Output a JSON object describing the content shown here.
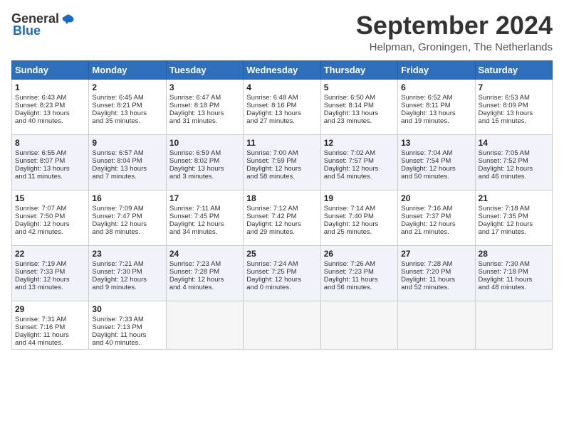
{
  "logo": {
    "general": "General",
    "blue": "Blue"
  },
  "title": "September 2024",
  "location": "Helpman, Groningen, The Netherlands",
  "days_of_week": [
    "Sunday",
    "Monday",
    "Tuesday",
    "Wednesday",
    "Thursday",
    "Friday",
    "Saturday"
  ],
  "weeks": [
    [
      {
        "num": "1",
        "lines": [
          "Sunrise: 6:43 AM",
          "Sunset: 8:23 PM",
          "Daylight: 13 hours",
          "and 40 minutes."
        ]
      },
      {
        "num": "2",
        "lines": [
          "Sunrise: 6:45 AM",
          "Sunset: 8:21 PM",
          "Daylight: 13 hours",
          "and 35 minutes."
        ]
      },
      {
        "num": "3",
        "lines": [
          "Sunrise: 6:47 AM",
          "Sunset: 8:18 PM",
          "Daylight: 13 hours",
          "and 31 minutes."
        ]
      },
      {
        "num": "4",
        "lines": [
          "Sunrise: 6:48 AM",
          "Sunset: 8:16 PM",
          "Daylight: 13 hours",
          "and 27 minutes."
        ]
      },
      {
        "num": "5",
        "lines": [
          "Sunrise: 6:50 AM",
          "Sunset: 8:14 PM",
          "Daylight: 13 hours",
          "and 23 minutes."
        ]
      },
      {
        "num": "6",
        "lines": [
          "Sunrise: 6:52 AM",
          "Sunset: 8:11 PM",
          "Daylight: 13 hours",
          "and 19 minutes."
        ]
      },
      {
        "num": "7",
        "lines": [
          "Sunrise: 6:53 AM",
          "Sunset: 8:09 PM",
          "Daylight: 13 hours",
          "and 15 minutes."
        ]
      }
    ],
    [
      {
        "num": "8",
        "lines": [
          "Sunrise: 6:55 AM",
          "Sunset: 8:07 PM",
          "Daylight: 13 hours",
          "and 11 minutes."
        ]
      },
      {
        "num": "9",
        "lines": [
          "Sunrise: 6:57 AM",
          "Sunset: 8:04 PM",
          "Daylight: 13 hours",
          "and 7 minutes."
        ]
      },
      {
        "num": "10",
        "lines": [
          "Sunrise: 6:59 AM",
          "Sunset: 8:02 PM",
          "Daylight: 13 hours",
          "and 3 minutes."
        ]
      },
      {
        "num": "11",
        "lines": [
          "Sunrise: 7:00 AM",
          "Sunset: 7:59 PM",
          "Daylight: 12 hours",
          "and 58 minutes."
        ]
      },
      {
        "num": "12",
        "lines": [
          "Sunrise: 7:02 AM",
          "Sunset: 7:57 PM",
          "Daylight: 12 hours",
          "and 54 minutes."
        ]
      },
      {
        "num": "13",
        "lines": [
          "Sunrise: 7:04 AM",
          "Sunset: 7:54 PM",
          "Daylight: 12 hours",
          "and 50 minutes."
        ]
      },
      {
        "num": "14",
        "lines": [
          "Sunrise: 7:05 AM",
          "Sunset: 7:52 PM",
          "Daylight: 12 hours",
          "and 46 minutes."
        ]
      }
    ],
    [
      {
        "num": "15",
        "lines": [
          "Sunrise: 7:07 AM",
          "Sunset: 7:50 PM",
          "Daylight: 12 hours",
          "and 42 minutes."
        ]
      },
      {
        "num": "16",
        "lines": [
          "Sunrise: 7:09 AM",
          "Sunset: 7:47 PM",
          "Daylight: 12 hours",
          "and 38 minutes."
        ]
      },
      {
        "num": "17",
        "lines": [
          "Sunrise: 7:11 AM",
          "Sunset: 7:45 PM",
          "Daylight: 12 hours",
          "and 34 minutes."
        ]
      },
      {
        "num": "18",
        "lines": [
          "Sunrise: 7:12 AM",
          "Sunset: 7:42 PM",
          "Daylight: 12 hours",
          "and 29 minutes."
        ]
      },
      {
        "num": "19",
        "lines": [
          "Sunrise: 7:14 AM",
          "Sunset: 7:40 PM",
          "Daylight: 12 hours",
          "and 25 minutes."
        ]
      },
      {
        "num": "20",
        "lines": [
          "Sunrise: 7:16 AM",
          "Sunset: 7:37 PM",
          "Daylight: 12 hours",
          "and 21 minutes."
        ]
      },
      {
        "num": "21",
        "lines": [
          "Sunrise: 7:18 AM",
          "Sunset: 7:35 PM",
          "Daylight: 12 hours",
          "and 17 minutes."
        ]
      }
    ],
    [
      {
        "num": "22",
        "lines": [
          "Sunrise: 7:19 AM",
          "Sunset: 7:33 PM",
          "Daylight: 12 hours",
          "and 13 minutes."
        ]
      },
      {
        "num": "23",
        "lines": [
          "Sunrise: 7:21 AM",
          "Sunset: 7:30 PM",
          "Daylight: 12 hours",
          "and 9 minutes."
        ]
      },
      {
        "num": "24",
        "lines": [
          "Sunrise: 7:23 AM",
          "Sunset: 7:28 PM",
          "Daylight: 12 hours",
          "and 4 minutes."
        ]
      },
      {
        "num": "25",
        "lines": [
          "Sunrise: 7:24 AM",
          "Sunset: 7:25 PM",
          "Daylight: 12 hours",
          "and 0 minutes."
        ]
      },
      {
        "num": "26",
        "lines": [
          "Sunrise: 7:26 AM",
          "Sunset: 7:23 PM",
          "Daylight: 11 hours",
          "and 56 minutes."
        ]
      },
      {
        "num": "27",
        "lines": [
          "Sunrise: 7:28 AM",
          "Sunset: 7:20 PM",
          "Daylight: 11 hours",
          "and 52 minutes."
        ]
      },
      {
        "num": "28",
        "lines": [
          "Sunrise: 7:30 AM",
          "Sunset: 7:18 PM",
          "Daylight: 11 hours",
          "and 48 minutes."
        ]
      }
    ],
    [
      {
        "num": "29",
        "lines": [
          "Sunrise: 7:31 AM",
          "Sunset: 7:16 PM",
          "Daylight: 11 hours",
          "and 44 minutes."
        ]
      },
      {
        "num": "30",
        "lines": [
          "Sunrise: 7:33 AM",
          "Sunset: 7:13 PM",
          "Daylight: 11 hours",
          "and 40 minutes."
        ]
      },
      {
        "num": "",
        "lines": []
      },
      {
        "num": "",
        "lines": []
      },
      {
        "num": "",
        "lines": []
      },
      {
        "num": "",
        "lines": []
      },
      {
        "num": "",
        "lines": []
      }
    ]
  ]
}
